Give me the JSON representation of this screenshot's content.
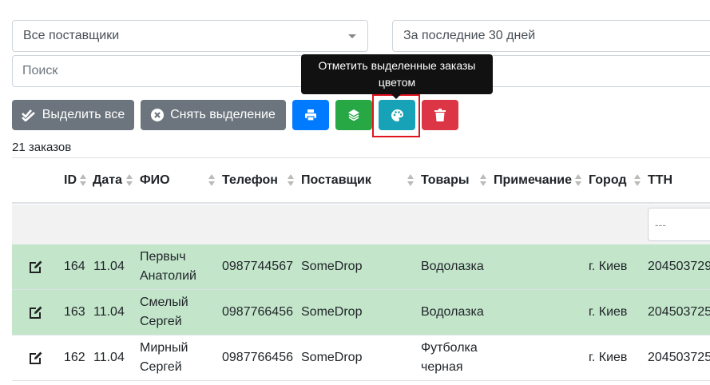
{
  "filters": {
    "supplier_select": "Все поставщики",
    "period_select": "За последние 30 дней",
    "search_placeholder": "Поиск"
  },
  "toolbar": {
    "select_all_label": "Выделить все",
    "deselect_label": "Снять выделение",
    "print_icon": "print-icon",
    "layers_icon": "layers-icon",
    "palette_icon": "palette-icon",
    "delete_icon": "trash-icon"
  },
  "tooltip": {
    "line1": "Отметить выделенные заказы",
    "line2": "цветом"
  },
  "orders_count": "21 заказов",
  "table": {
    "headers": {
      "id": "ID",
      "date": "Дата",
      "name": "ФИО",
      "phone": "Телефон",
      "supplier": "Поставщик",
      "goods": "Товары",
      "note": "Примечание",
      "city": "Город",
      "ttn": "ТТН"
    },
    "filter_placeholder": "---",
    "rows": [
      {
        "id": "164",
        "date": "11.04",
        "name1": "Первыч",
        "name2": "Анатолий",
        "phone": "0987744567",
        "supplier": "SomeDrop",
        "goods1": "Водолазка",
        "goods2": "",
        "note": "",
        "city": "г. Киев",
        "ttn": "204503729",
        "highlight": "#c3e6cb"
      },
      {
        "id": "163",
        "date": "11.04",
        "name1": "Смелый",
        "name2": "Сергей",
        "phone": "0987766456",
        "supplier": "SomeDrop",
        "goods1": "Водолазка",
        "goods2": "",
        "note": "",
        "city": "г. Киев",
        "ttn": "204503725",
        "highlight": "#c3e6cb"
      },
      {
        "id": "162",
        "date": "11.04",
        "name1": "Мирный",
        "name2": "Сергей",
        "phone": "0987766456",
        "supplier": "SomeDrop",
        "goods1": "Футболка",
        "goods2": "черная",
        "note": "",
        "city": "г. Киев",
        "ttn": "204503725",
        "highlight": ""
      }
    ]
  },
  "colors": {
    "grey_button": "#6c757d",
    "print_button": "#007bff",
    "layers_button": "#28a745",
    "palette_button": "#17a2b8",
    "delete_button": "#dc3545",
    "highlight_frame": "#e0141e",
    "marked_row": "#c3e6cb"
  }
}
